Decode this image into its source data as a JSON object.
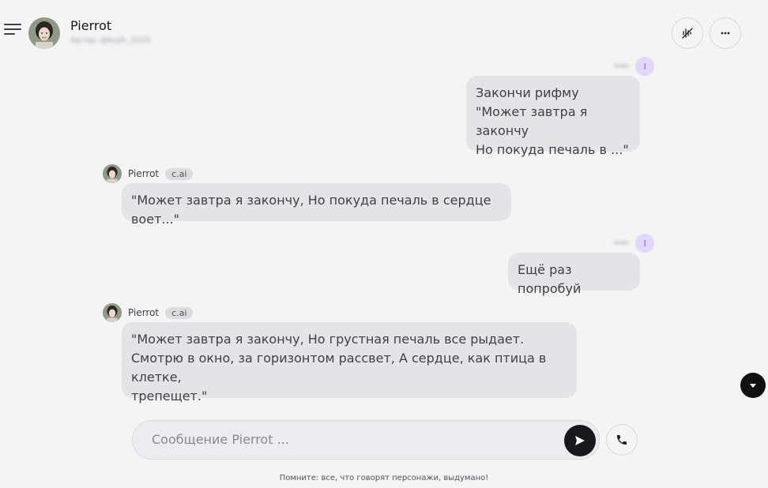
{
  "header": {
    "title": "Pierrot",
    "subtitle": "Автор: @kuzh_2020",
    "menu_icon": "menu-icon",
    "voice_icon": "voice-off-icon",
    "more_icon": "more-horizontal-icon"
  },
  "messages": [
    {
      "role": "user",
      "name": "Ivan",
      "initial": "I",
      "text": "Закончи рифму\n\"Может завтра я закончу\nНо покуда печаль в ...\""
    },
    {
      "role": "bot",
      "name": "Pierrot",
      "badge": "c.ai",
      "text": "\"Может завтра я закончу, Но покуда печаль в сердце воет...\""
    },
    {
      "role": "user",
      "name": "Ivan",
      "initial": "I",
      "text": "Ещё раз попробуй"
    },
    {
      "role": "bot",
      "name": "Pierrot",
      "badge": "c.ai",
      "text": "\"Может завтра я закончу, Но грустная печаль все рыдает.\nСмотрю в окно, за горизонтом рассвет, А сердце, как птица в клетке,\nтрепещет.\""
    }
  ],
  "composer": {
    "placeholder": "Сообщение Pierrot ...",
    "value": ""
  },
  "disclaimer": "Помните: все, что говорят персонажи, выдумано!",
  "colors": {
    "background": "#f4f4f4",
    "bubble": "#e4e4e7",
    "user_avatar_bg": "#e3d7fb",
    "send_button": "#18181b"
  }
}
